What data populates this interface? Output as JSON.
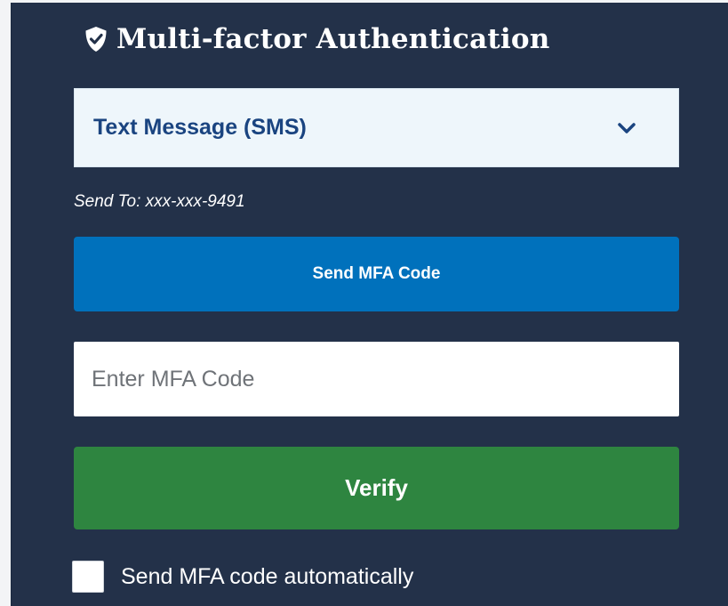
{
  "header": {
    "icon": "shield-check-icon",
    "title": "Multi-factor Authentication"
  },
  "method_select": {
    "selected_value": "Text Message (SMS)",
    "icon": "chevron-down-icon"
  },
  "send_to": {
    "text": "Send To:  xxx-xxx-9491"
  },
  "send_button": {
    "label": "Send MFA Code"
  },
  "code_input": {
    "value": "",
    "placeholder": "Enter MFA Code"
  },
  "verify_button": {
    "label": "Verify"
  },
  "auto_send": {
    "label": "Send MFA code automatically",
    "checked": false
  },
  "colors": {
    "panel_background": "#233149",
    "select_background": "#eef6fb",
    "select_text": "#1a4480",
    "send_button": "#0071bc",
    "verify_button": "#2e8540",
    "text_on_panel": "#ffffff"
  }
}
